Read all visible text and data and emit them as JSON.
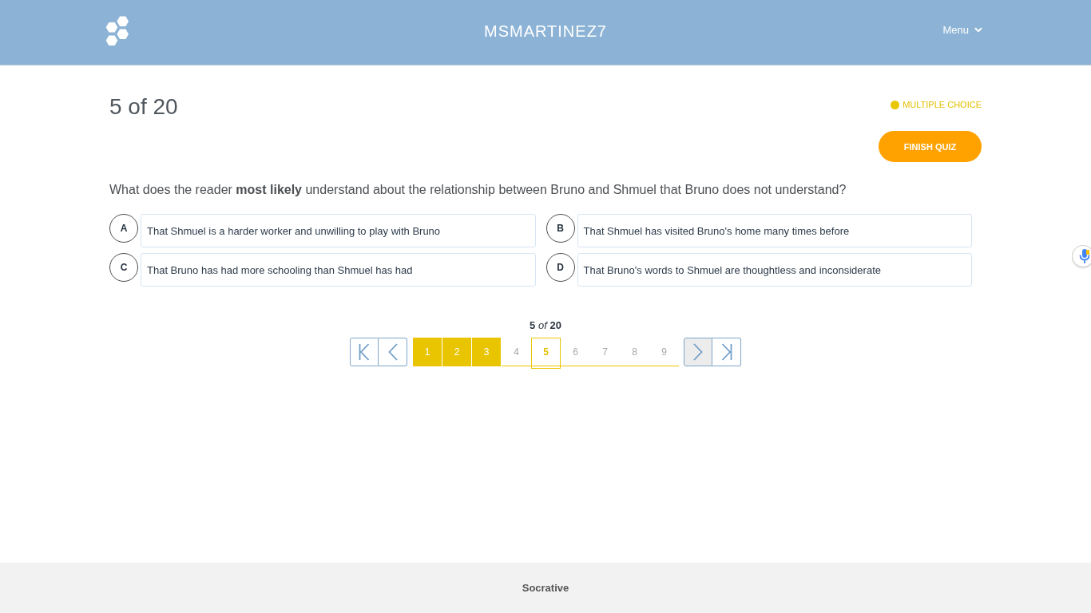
{
  "header": {
    "title": "MSMARTINEZ7",
    "menu": "Menu"
  },
  "counter": "5 of 20",
  "question_type": "MULTIPLE CHOICE",
  "finish_button": "FINISH QUIZ",
  "question": "What does the reader **most likely** understand about the relationship between Bruno and Shmuel that Bruno does not understand?",
  "answers": [
    {
      "letter": "A",
      "text": "That Shmuel is a harder worker and unwilling to play with Bruno",
      "selected": false
    },
    {
      "letter": "B",
      "text": "That Shmuel has visited Bruno's home many times before",
      "selected": false
    },
    {
      "letter": "C",
      "text": "That Bruno has had more schooling than Shmuel has had",
      "selected": false
    },
    {
      "letter": "D",
      "text": "That Bruno's words to Shmuel are thoughtless and inconsiderate",
      "selected": false
    }
  ],
  "pagination": {
    "caption": "**5** *of* **20**",
    "nav_start": [
      {
        "kind": "first",
        "highlighted": false
      },
      {
        "kind": "previous",
        "highlighted": false
      }
    ],
    "pages": [
      {
        "label": "1",
        "answered": true,
        "selected": false
      },
      {
        "label": "2",
        "answered": true,
        "selected": false
      },
      {
        "label": "3",
        "answered": true,
        "selected": false
      },
      {
        "label": "4",
        "answered": false,
        "selected": false
      },
      {
        "label": "5",
        "answered": false,
        "selected": true
      },
      {
        "label": "6",
        "answered": false,
        "selected": false
      },
      {
        "label": "7",
        "answered": false,
        "selected": false
      },
      {
        "label": "8",
        "answered": false,
        "selected": false
      },
      {
        "label": "9",
        "answered": false,
        "selected": false
      }
    ],
    "nav_end": [
      {
        "kind": "next",
        "highlighted": true
      },
      {
        "kind": "last",
        "highlighted": false
      }
    ]
  },
  "footer": "Socrative"
}
